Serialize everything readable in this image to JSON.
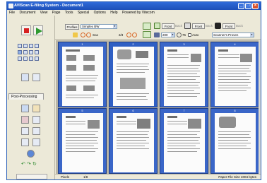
{
  "window": {
    "title": "AVIScan E-filing System - Document1",
    "minimize": "_",
    "maximize": "□",
    "close": "×"
  },
  "menu": [
    "File",
    "Document",
    "View",
    "Page",
    "Tools",
    "Special",
    "Options",
    "Help",
    "Powered by Vitecom"
  ],
  "toolbar": {
    "profiles_label": "Profiles",
    "profile_value": "Simplex BW",
    "scan_label": "Sca",
    "page_count": "2/3",
    "front_label": "Front",
    "back_label": "Back",
    "zoom_value": "200",
    "dpi_value": "75",
    "auto_label": "Auto",
    "source_value": "Scanner's Proven"
  },
  "sidebar": {
    "post_processing_label": "Post-Processing"
  },
  "pages": [
    {
      "number": "1",
      "layout": "catalog"
    },
    {
      "number": "2",
      "layout": "product"
    },
    {
      "number": "3",
      "layout": "text-photo"
    },
    {
      "number": "4",
      "layout": "text-photo"
    },
    {
      "number": "5",
      "layout": "text-photo"
    },
    {
      "number": "6",
      "layout": "text-photo"
    },
    {
      "number": "7",
      "layout": "text-photo"
    },
    {
      "number": "8",
      "layout": "product"
    }
  ],
  "status": {
    "mode": "Pixels",
    "page_indicator": "1/8",
    "paper_size": "Paper File Size  4004 bytes"
  },
  "colors": {
    "titlebar": "#1d4fb8",
    "thumbnail_frame": "#3a66c8",
    "stop_button": "#d62020",
    "play_button": "#2f9a2f"
  }
}
